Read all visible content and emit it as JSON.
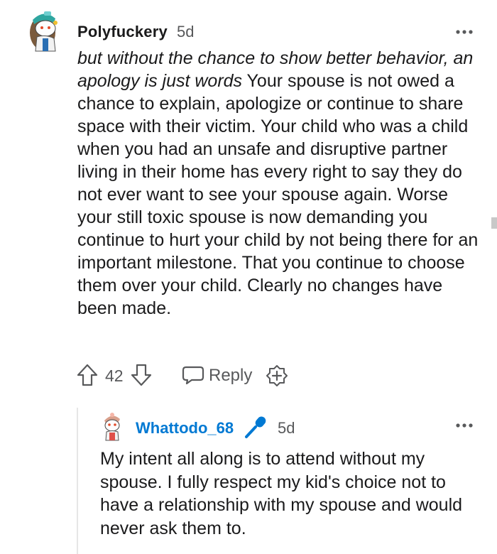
{
  "comment": {
    "username": "Polyfuckery",
    "age": "5d",
    "quote": "but without the chance to show better behavior, an apology is just words",
    "body": " Your spouse is not owed a chance to explain, apologize or continue to share space with their victim. Your child who was a child when you had an unsafe and disruptive partner living in their home has every right to say they do not ever want to see your spouse again. Worse your still toxic spouse is now demanding you continue to hurt your child by not being there for an important milestone. That you continue to choose them over your child. Clearly no changes have been made.",
    "score": "42",
    "reply_label": "Reply",
    "icons": {
      "avatar": "snoo-avatar-icon",
      "more": "more-options-icon",
      "upvote": "upvote-arrow-icon",
      "downvote": "downvote-arrow-icon",
      "reply": "speech-bubble-icon",
      "award": "award-plus-icon"
    }
  },
  "reply": {
    "username": "Whattodo_68",
    "age": "5d",
    "body": "My intent all along is to attend without my spouse. I fully respect my kid's choice not to have a relationship with my spouse and would never ask them to.",
    "icons": {
      "avatar": "snoo-avatar-icon",
      "op_badge": "microphone-icon",
      "more": "more-options-icon"
    }
  },
  "colors": {
    "text": "#1a1a1b",
    "meta": "#58595b",
    "op_username": "#0079d3",
    "thread_line": "#e6e6e6"
  }
}
